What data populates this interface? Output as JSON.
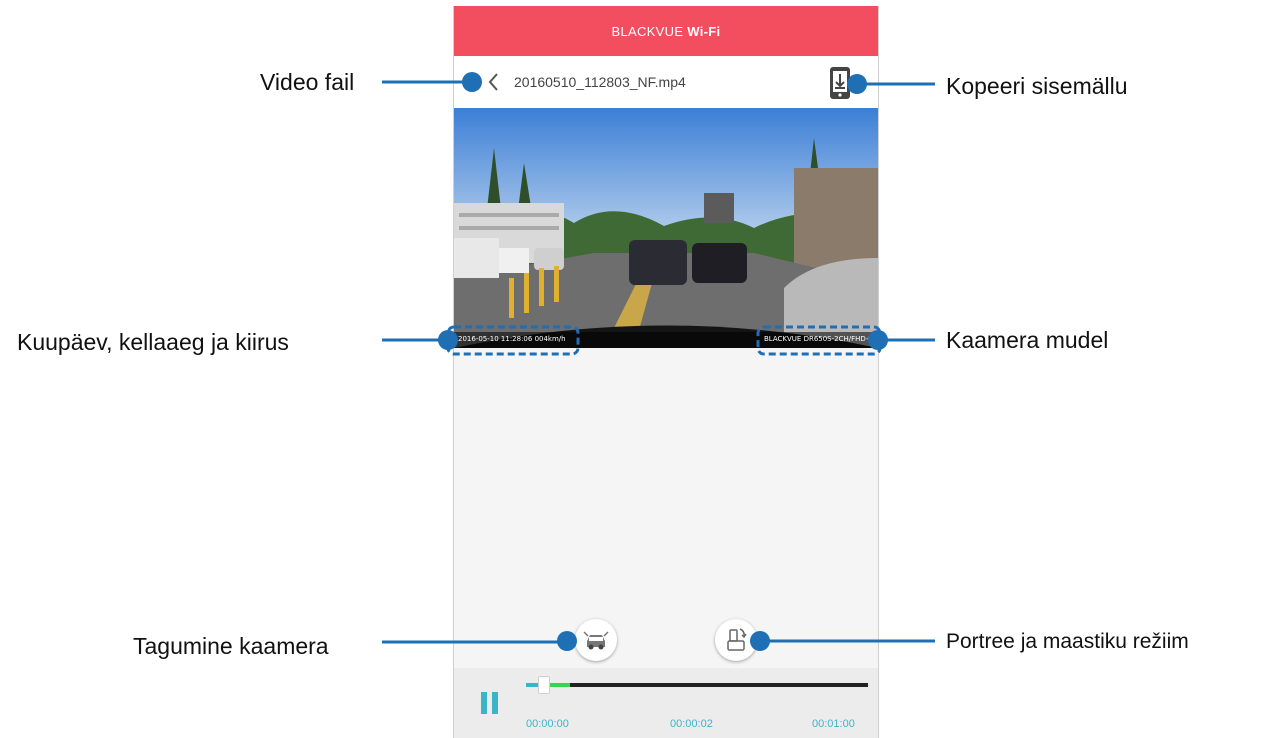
{
  "app": {
    "title_prefix": "BLACKVUE",
    "title_suffix": "Wi-Fi",
    "brand_color": "#f24e5f",
    "accent_color": "#3ab5c8"
  },
  "header": {
    "back_icon": "chevron-left-icon",
    "file_name": "20160510_112803_NF.mp4",
    "copy_icon": "phone-download-icon"
  },
  "video": {
    "overlay_left": "2016-05-10 11:28:06   004km/h",
    "overlay_right": "BLACKVUE DR650S-2CH/FHD+"
  },
  "controls": {
    "rear_camera_icon": "rear-car-icon",
    "rotate_icon": "rotate-phone-icon",
    "pause_icon": "pause-icon",
    "progress_fraction": 0.05,
    "buffered_fraction": 0.13,
    "time_start": "00:00:00",
    "time_current": "00:00:02",
    "time_end": "00:01:00"
  },
  "annotations": {
    "video_file": "Video fail",
    "copy_to_phone": "Kopeeri sisemällu",
    "date_time_speed": "Kuupäev, kellaaeg ja kiirus",
    "camera_model": "Kaamera mudel",
    "rear_camera": "Tagumine kaamera",
    "orientation_mode": "Portree ja maastiku režiim",
    "callout_color": "#1f6fb5"
  }
}
